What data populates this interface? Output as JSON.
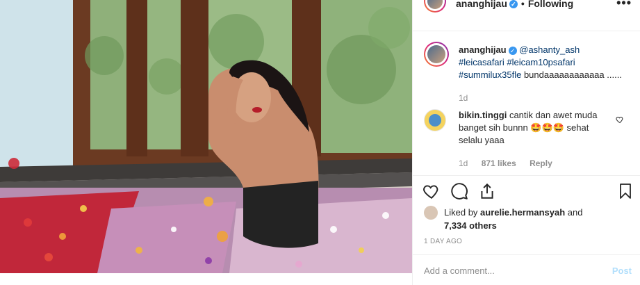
{
  "header": {
    "username": "ananghijau",
    "verified_mark": "✓",
    "separator": "•",
    "follow_status": "Following",
    "more_icon": "more-dots-icon"
  },
  "caption": {
    "username": "ananghijau",
    "mention": "@ashanty_ash",
    "hashtags": [
      "#leicasafari",
      "#leicam10psafari",
      "#summilux35fle"
    ],
    "text": "bundaaaaaaaaaaaa ......",
    "time": "1d"
  },
  "comment": {
    "username": "bikin.tinggi",
    "text": "cantik dan awet muda banget sih bunnn 🤩🤩🤩 sehat selalu yaaa",
    "time": "1d",
    "likes": "871 likes",
    "reply_label": "Reply"
  },
  "actions": {
    "icons": [
      "heart-icon",
      "comment-icon",
      "share-icon",
      "bookmark-icon"
    ]
  },
  "likes": {
    "prefix": "Liked by",
    "liker": "aurelie.hermansyah",
    "and": "and",
    "others": "7,334 others"
  },
  "posted_ago": "1 DAY AGO",
  "add_comment": {
    "placeholder": "Add a comment...",
    "post_label": "Post"
  },
  "colors": {
    "link": "#003569",
    "verified": "#3897f0",
    "muted": "#8e8e8e",
    "post_disabled": "#b2dffc"
  }
}
